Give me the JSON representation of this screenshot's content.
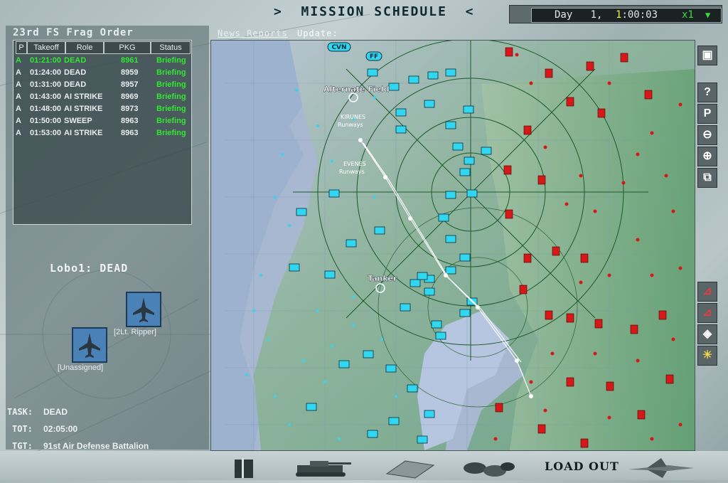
{
  "header": {
    "title": ">  MISSION SCHEDULE  <",
    "clock": {
      "day_label": "Day",
      "day": "1,",
      "time_hl": "1",
      "time_rest": ":00:03",
      "speed": "x1",
      "arrow": "▼"
    }
  },
  "frag_order": {
    "title": "23rd FS Frag Order",
    "columns": [
      "P",
      "Takeoff",
      "Role",
      "PKG",
      "Status"
    ],
    "rows": [
      {
        "p": "A",
        "takeoff": "01:21:00",
        "role": "DEAD",
        "pkg": "8961",
        "status": "Briefing"
      },
      {
        "p": "A",
        "takeoff": "01:24:00",
        "role": "DEAD",
        "pkg": "8959",
        "status": "Briefing"
      },
      {
        "p": "A",
        "takeoff": "01:31:00",
        "role": "DEAD",
        "pkg": "8957",
        "status": "Briefing"
      },
      {
        "p": "A",
        "takeoff": "01:43:00",
        "role": "AI STRIKE",
        "pkg": "8969",
        "status": "Briefing"
      },
      {
        "p": "A",
        "takeoff": "01:48:00",
        "role": "AI STRIKE",
        "pkg": "8973",
        "status": "Briefing"
      },
      {
        "p": "A",
        "takeoff": "01:50:00",
        "role": "SWEEP",
        "pkg": "8963",
        "status": "Briefing"
      },
      {
        "p": "A",
        "takeoff": "01:53:00",
        "role": "AI STRIKE",
        "pkg": "8963",
        "status": "Briefing"
      }
    ]
  },
  "flight": {
    "name": "Lobo1: DEAD",
    "pilots": [
      "[2Lt. Ripper]",
      "[Unassigned]"
    ]
  },
  "mission": {
    "task_label": "TASK:",
    "task": "DEAD",
    "tot_label": "TOT:",
    "tot": "02:05:00",
    "tgt_label": "TGT:",
    "tgt": "91st Air Defense Battalion"
  },
  "map": {
    "news_link": "News Reports",
    "update_label": "Update:",
    "labels": {
      "cvn": "CVN",
      "alternate": "Alternate Field",
      "tanker": "Tanker",
      "ff": "FF",
      "runways1": "Runways",
      "runways2": "Runways",
      "evenes": "EVENES",
      "kiruna": "KIRUNES"
    },
    "colors": {
      "friendly": "#31d7f0",
      "enemy": "#d81818",
      "route": "#ffffff",
      "rings": "#1d5a2a"
    }
  },
  "toolbar": {
    "help": "?",
    "pin": "P"
  },
  "bottom": {
    "loadout": "LOAD OUT"
  }
}
